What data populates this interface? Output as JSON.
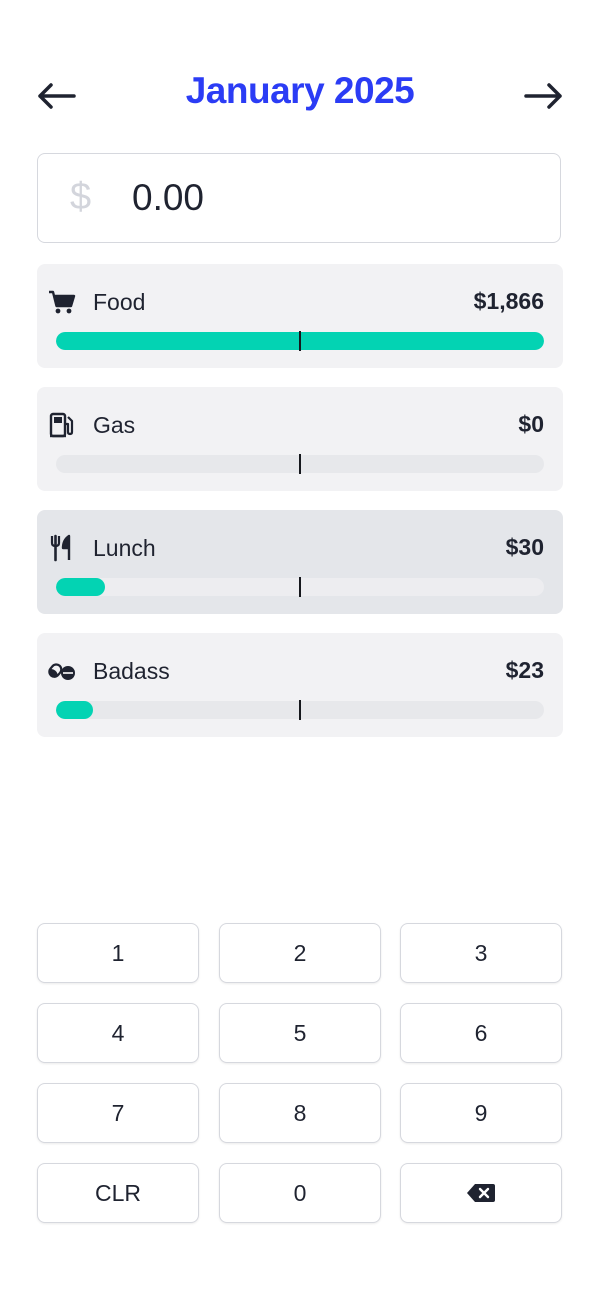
{
  "header": {
    "month_title": "January 2025",
    "prev_icon": "arrow-left-icon",
    "next_icon": "arrow-right-icon",
    "accent_color": "#2b3cf5"
  },
  "amount_input": {
    "currency_symbol": "$",
    "value": "0.00"
  },
  "categories": [
    {
      "name": "Food",
      "amount": "$1,866",
      "icon": "shopping-cart-icon",
      "progress": 1.0,
      "selected": false
    },
    {
      "name": "Gas",
      "amount": "$0",
      "icon": "gas-pump-icon",
      "progress": 0.0,
      "selected": false
    },
    {
      "name": "Lunch",
      "amount": "$30",
      "icon": "utensils-icon",
      "progress": 0.1,
      "selected": true
    },
    {
      "name": "Badass",
      "amount": "$23",
      "icon": "pills-icon",
      "progress": 0.075,
      "selected": false
    }
  ],
  "progress_color": "#03d3b3",
  "keypad": {
    "keys": [
      "1",
      "2",
      "3",
      "4",
      "5",
      "6",
      "7",
      "8",
      "9",
      "CLR",
      "0"
    ],
    "backspace_icon": "backspace-icon"
  }
}
